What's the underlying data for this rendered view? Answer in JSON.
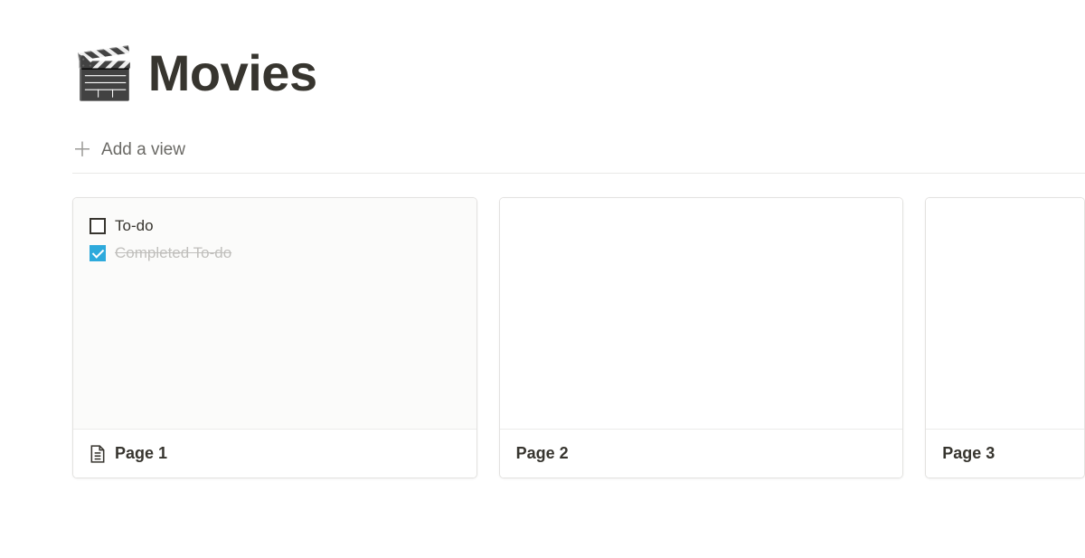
{
  "header": {
    "icon": "🎬",
    "title": "Movies",
    "add_view_label": "Add a view"
  },
  "cards": [
    {
      "title": "Page 1",
      "has_icon": true,
      "todos": [
        {
          "label": "To-do",
          "checked": false
        },
        {
          "label": "Completed To-do",
          "checked": true
        }
      ]
    },
    {
      "title": "Page 2",
      "has_icon": false,
      "todos": []
    },
    {
      "title": "Page 3",
      "has_icon": false,
      "todos": []
    }
  ]
}
